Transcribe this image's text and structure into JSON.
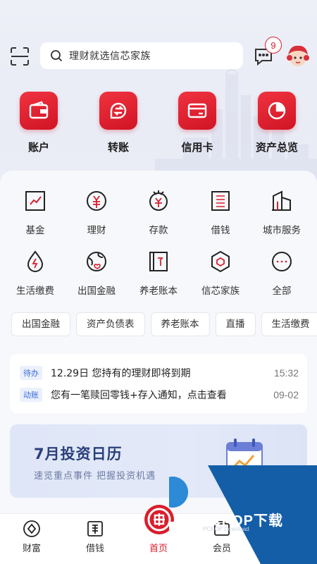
{
  "header": {
    "search_placeholder": "理财就选信芯家族",
    "message_badge": "9"
  },
  "quick": [
    {
      "label": "账户",
      "icon": "wallet-icon"
    },
    {
      "label": "转账",
      "icon": "transfer-icon"
    },
    {
      "label": "信用卡",
      "icon": "credit-card-icon"
    },
    {
      "label": "资产总览",
      "icon": "pie-chart-icon"
    }
  ],
  "services": [
    {
      "label": "基金",
      "icon": "fund-chart-icon"
    },
    {
      "label": "理财",
      "icon": "yuan-coin-icon"
    },
    {
      "label": "存款",
      "icon": "deposit-icon"
    },
    {
      "label": "借钱",
      "icon": "borrow-icon"
    },
    {
      "label": "城市服务",
      "icon": "city-building-icon"
    },
    {
      "label": "生活缴费",
      "icon": "utility-drop-icon"
    },
    {
      "label": "出国金融",
      "icon": "globe-heart-icon"
    },
    {
      "label": "养老账本",
      "icon": "pension-book-icon"
    },
    {
      "label": "信芯家族",
      "icon": "hexagon-icon"
    },
    {
      "label": "全部",
      "icon": "more-icon"
    }
  ],
  "chips": [
    "出国金融",
    "资产负债表",
    "养老账本",
    "直播",
    "生活缴费"
  ],
  "notices": [
    {
      "tag": "待办",
      "text": "12.29日 您持有的理财即将到期",
      "time": "15:32"
    },
    {
      "tag": "动账",
      "text": "您有一笔赎回零钱+存入通知，点击查看",
      "time": "09-02"
    }
  ],
  "banner": {
    "title": "7月投资日历",
    "subtitle": "速览重点事件 把握投资机遇"
  },
  "tabs": [
    {
      "label": "财富",
      "icon": "diamond-icon"
    },
    {
      "label": "借钱",
      "icon": "borrow-tab-icon"
    },
    {
      "label": "首页",
      "icon": "bank-logo-icon"
    },
    {
      "label": "会员",
      "icon": "member-icon"
    }
  ],
  "watermark": {
    "text": "PCPOP下载",
    "sub": "PCPOP Download"
  },
  "colors": {
    "brand_red": "#d81e2c",
    "tag_blue": "#3d6bd6",
    "banner_title": "#2a3f7a"
  }
}
